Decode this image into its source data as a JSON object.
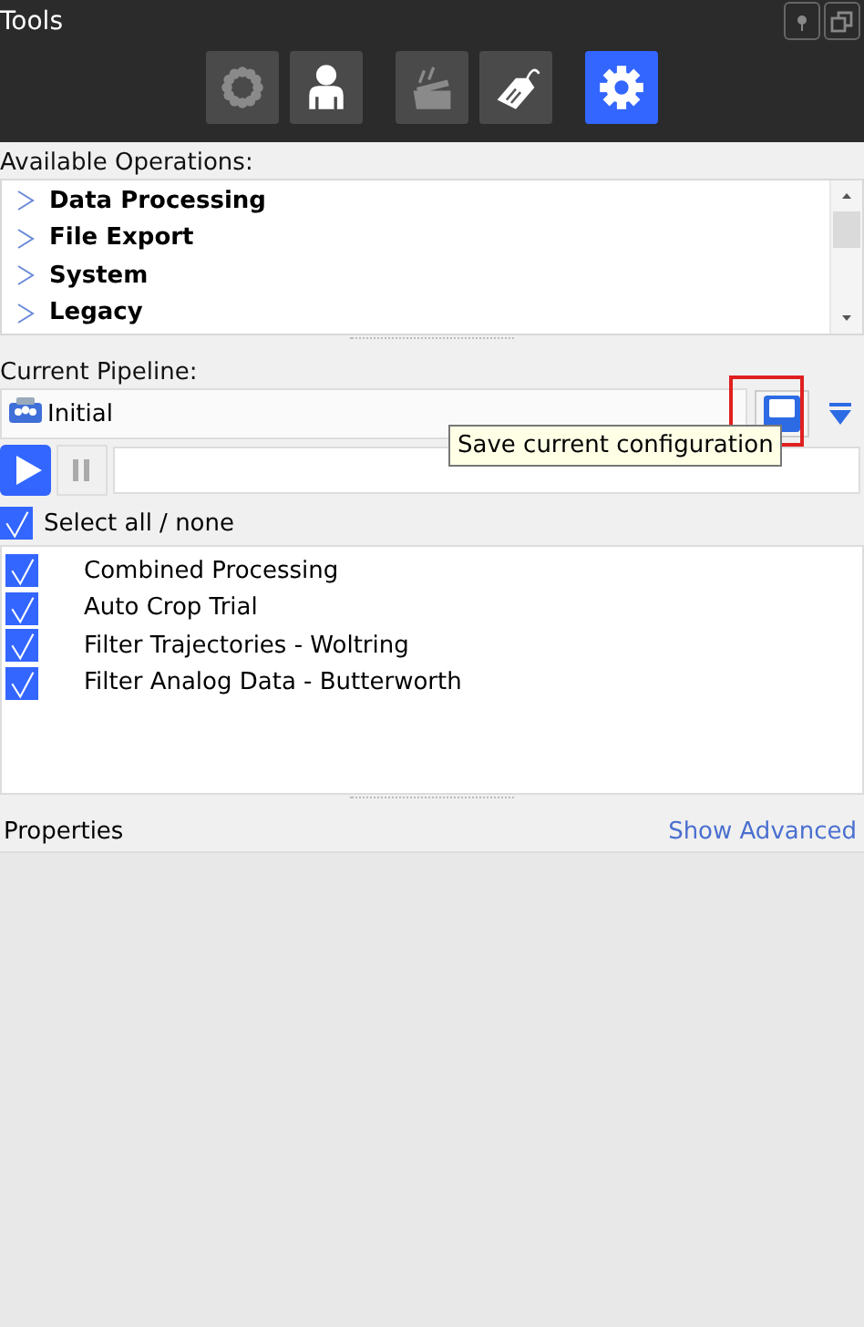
{
  "window": {
    "title": "Tools"
  },
  "toolbar": [
    {
      "kind": "markers",
      "selected": false,
      "disabled": true
    },
    {
      "kind": "person",
      "selected": false,
      "disabled": false
    },
    {
      "kind": "clapper",
      "selected": false,
      "disabled": true
    },
    {
      "kind": "tag",
      "selected": false,
      "disabled": false
    },
    {
      "kind": "gear",
      "selected": true,
      "disabled": false
    }
  ],
  "operations": {
    "label": "Available Operations:",
    "items": [
      {
        "label": "Data Processing",
        "expanded": false
      },
      {
        "label": "File Export",
        "expanded": false
      },
      {
        "label": "System",
        "expanded": false
      },
      {
        "label": "Legacy",
        "expanded": false
      }
    ]
  },
  "pipeline": {
    "label": "Current Pipeline:",
    "name": "Initial",
    "tooltip": "Save current configuration",
    "select_all": {
      "label": "Select all / none",
      "checked": true
    },
    "steps": [
      {
        "label": "Combined Processing",
        "checked": true
      },
      {
        "label": "Auto Crop Trial",
        "checked": true
      },
      {
        "label": "Filter Trajectories - Woltring",
        "checked": true
      },
      {
        "label": "Filter Analog Data - Butterworth",
        "checked": true
      }
    ]
  },
  "properties": {
    "label": "Properties",
    "link": "Show Advanced"
  }
}
